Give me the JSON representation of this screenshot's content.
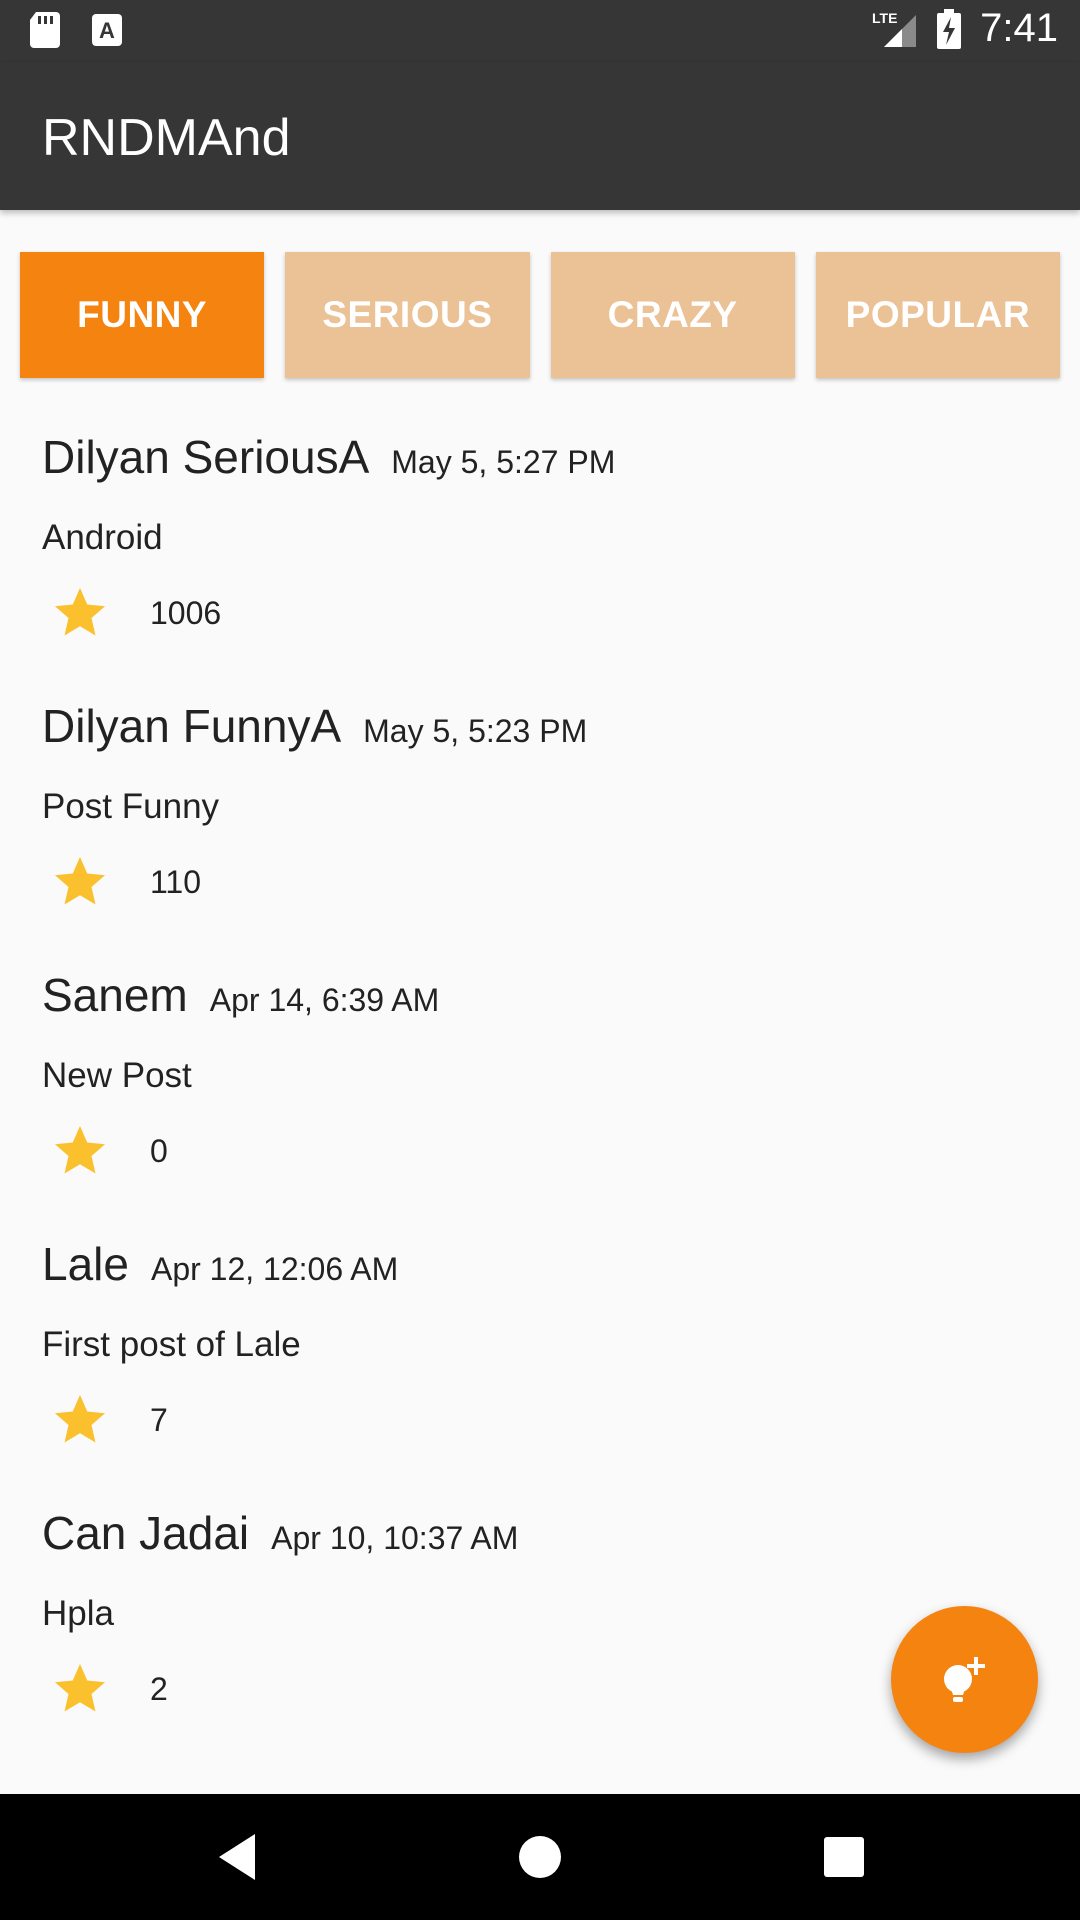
{
  "status_bar": {
    "time": "7:41",
    "network_label": "LTE",
    "icons": [
      "sd-card-icon",
      "a-notification-icon",
      "lte-signal-icon",
      "battery-charging-icon"
    ]
  },
  "app": {
    "title": "RNDMAnd"
  },
  "tabs": [
    {
      "label": "FUNNY",
      "selected": true
    },
    {
      "label": "SERIOUS",
      "selected": false
    },
    {
      "label": "CRAZY",
      "selected": false
    },
    {
      "label": "POPULAR",
      "selected": false
    }
  ],
  "posts": [
    {
      "name": "Dilyan SeriousA",
      "date": "May 5, 5:27 PM",
      "text": "Android",
      "likes": "1006"
    },
    {
      "name": "Dilyan FunnyA",
      "date": "May 5, 5:23 PM",
      "text": "Post Funny",
      "likes": "110"
    },
    {
      "name": "Sanem",
      "date": "Apr 14, 6:39 AM",
      "text": "New Post",
      "likes": "0"
    },
    {
      "name": "Lale",
      "date": "Apr 12, 12:06 AM",
      "text": "First post of Lale",
      "likes": "7"
    },
    {
      "name": "Can Jadai",
      "date": "Apr 10, 10:37 AM",
      "text": "Hpla",
      "likes": "2"
    }
  ],
  "fab": {
    "icon": "add-idea-lightbulb-icon"
  },
  "colors": {
    "app_bar": "#363636",
    "accent": "#f5830f",
    "tab_inactive": "#ebc196",
    "star": "#fbc02d",
    "background": "#fafafa"
  },
  "nav_bar": {
    "icons": [
      "back-icon",
      "home-icon",
      "recents-icon"
    ]
  }
}
